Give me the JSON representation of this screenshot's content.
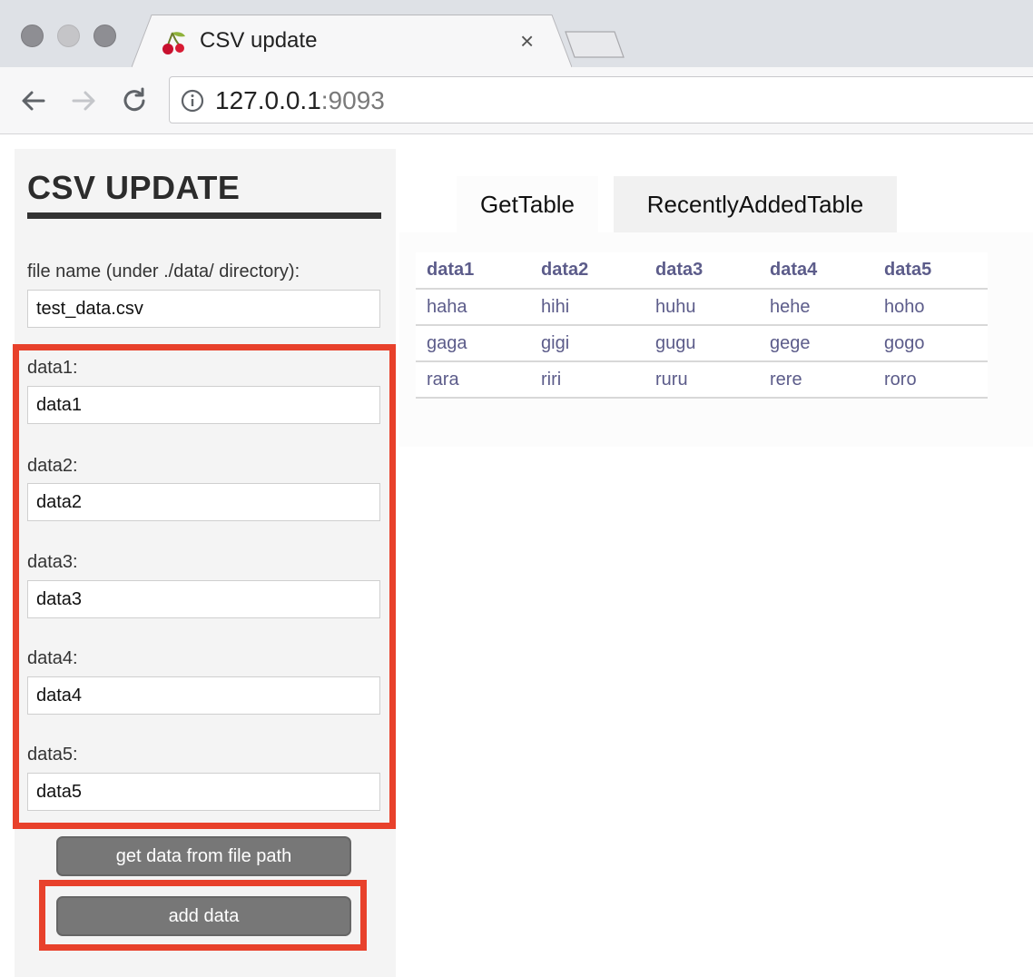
{
  "browser": {
    "tab_title": "CSV update",
    "tab_close": "×",
    "url_host": "127.0.0.1",
    "url_port": ":9093"
  },
  "sidebar": {
    "title": "CSV UPDATE",
    "file_label": "file name (under ./data/ directory):",
    "file_value": "test_data.csv",
    "fields": [
      {
        "label": "data1:",
        "value": "data1"
      },
      {
        "label": "data2:",
        "value": "data2"
      },
      {
        "label": "data3:",
        "value": "data3"
      },
      {
        "label": "data4:",
        "value": "data4"
      },
      {
        "label": "data5:",
        "value": "data5"
      }
    ],
    "get_button": "get data from file path",
    "add_button": "add data"
  },
  "main": {
    "tabs": [
      {
        "label": "GetTable"
      },
      {
        "label": "RecentlyAddedTable"
      }
    ],
    "table": {
      "headers": [
        "data1",
        "data2",
        "data3",
        "data4",
        "data5"
      ],
      "rows": [
        [
          "haha",
          "hihi",
          "huhu",
          "hehe",
          "hoho"
        ],
        [
          "gaga",
          "gigi",
          "gugu",
          "gege",
          "gogo"
        ],
        [
          "rara",
          "riri",
          "ruru",
          "rere",
          "roro"
        ]
      ]
    }
  },
  "colors": {
    "highlight": "#e8412b",
    "button": "#777777",
    "table_text": "#5c5c8a"
  }
}
